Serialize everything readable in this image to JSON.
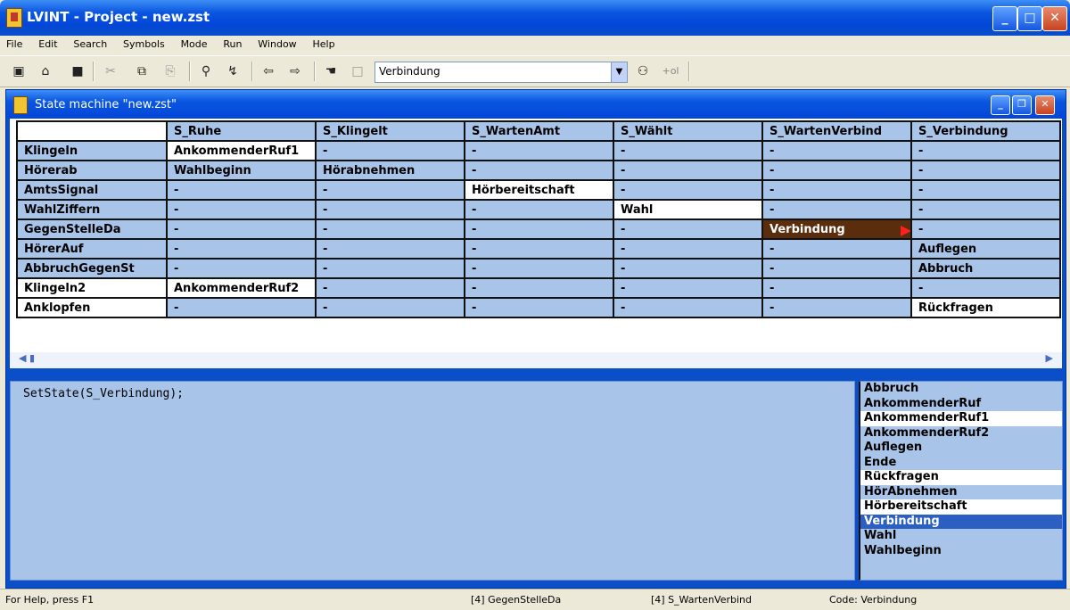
{
  "window": {
    "title": "LVINT - Project - new.zst"
  },
  "menu": [
    "File",
    "Edit",
    "Search",
    "Symbols",
    "Mode",
    "Run",
    "Window",
    "Help"
  ],
  "toolbar": {
    "combo_value": "Verbindung",
    "zoom_label": "+ol"
  },
  "inner_window": {
    "title": "State machine \"new.zst\""
  },
  "table": {
    "columns": [
      "S_Ruhe",
      "S_Klingelt",
      "S_WartenAmt",
      "S_Wählt",
      "S_WartenVerbind",
      "S_Verbindung"
    ],
    "rows": [
      {
        "label": "Klingeln",
        "cells": [
          "AnkommenderRuf1",
          "-",
          "-",
          "-",
          "-",
          "-"
        ]
      },
      {
        "label": "Hörerab",
        "cells": [
          "Wahlbeginn",
          "Hörabnehmen",
          "-",
          "-",
          "-",
          "-"
        ]
      },
      {
        "label": "AmtsSignal",
        "cells": [
          "-",
          "-",
          "Hörbereitschaft",
          "-",
          "-",
          "-"
        ]
      },
      {
        "label": "WahlZiffern",
        "cells": [
          "-",
          "-",
          "-",
          "Wahl",
          "-",
          "-"
        ]
      },
      {
        "label": "GegenStelleDa",
        "cells": [
          "-",
          "-",
          "-",
          "-",
          "Verbindung",
          "-"
        ]
      },
      {
        "label": "HörerAuf",
        "cells": [
          "-",
          "-",
          "-",
          "-",
          "-",
          "Auflegen"
        ]
      },
      {
        "label": "AbbruchGegenSt",
        "cells": [
          "-",
          "-",
          "-",
          "-",
          "-",
          "Abbruch"
        ]
      },
      {
        "label": "Klingeln2",
        "cells": [
          "AnkommenderRuf2",
          "-",
          "-",
          "-",
          "-",
          "-"
        ]
      },
      {
        "label": "Anklopfen",
        "cells": [
          "-",
          "-",
          "-",
          "-",
          "-",
          "Rückfragen"
        ]
      }
    ]
  },
  "code": "SetState(S_Verbindung);",
  "actions": [
    "Abbruch",
    "AnkommenderRuf",
    "AnkommenderRuf1",
    "AnkommenderRuf2",
    "Auflegen",
    "Ende",
    "Rückfragen",
    "HörAbnehmen",
    "Hörbereitschaft",
    "Verbindung",
    "Wahl",
    "Wahlbeginn"
  ],
  "status": {
    "left": "For Help, press F1",
    "event": "[4]  GegenStelleDa",
    "state": "[4]  S_WartenVerbind",
    "code": "Code: Verbindung"
  }
}
